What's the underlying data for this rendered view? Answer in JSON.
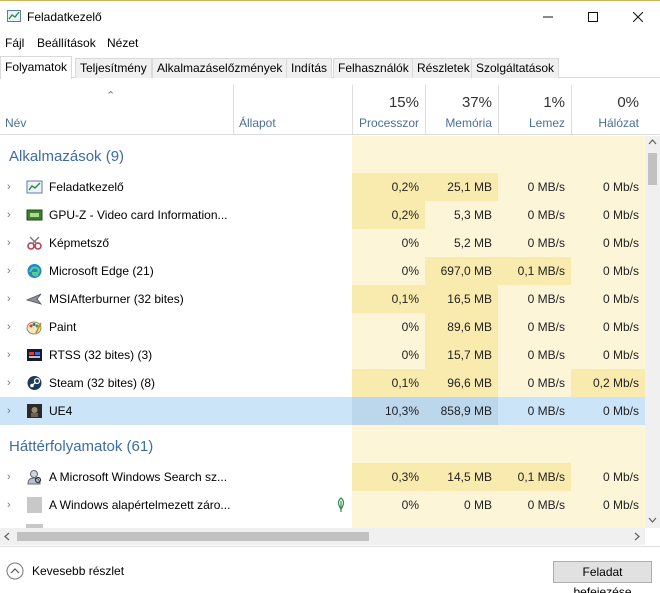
{
  "window": {
    "title": "Feladatkezelő",
    "minimize_icon": "minimize-icon",
    "maximize_icon": "maximize-icon",
    "close_icon": "close-icon"
  },
  "menu": [
    "Fájl",
    "Beállítások",
    "Nézet"
  ],
  "tabs": [
    "Folyamatok",
    "Teljesítmény",
    "Alkalmazáselőzmények",
    "Indítás",
    "Felhasználók",
    "Részletek",
    "Szolgáltatások"
  ],
  "active_tab": "Folyamatok",
  "header": {
    "name": "Név",
    "status": "Állapot",
    "cpu_pct": "15%",
    "cpu_label": "Processzor",
    "mem_pct": "37%",
    "mem_label": "Memória",
    "disk_pct": "1%",
    "disk_label": "Lemez",
    "net_pct": "0%",
    "net_label": "Hálózat"
  },
  "groups": {
    "apps": "Alkalmazások (9)",
    "background": "Háttérfolyamatok (61)"
  },
  "apps": [
    {
      "name": "Feladatkezelő",
      "icon": "task-manager-icon",
      "cpu": "0,2%",
      "mem": "25,1 MB",
      "disk": "0 MB/s",
      "net": "0 Mb/s"
    },
    {
      "name": "GPU-Z - Video card Information...",
      "icon": "gpu-z-icon",
      "cpu": "0,2%",
      "mem": "5,3 MB",
      "disk": "0 MB/s",
      "net": "0 Mb/s"
    },
    {
      "name": "Képmetsző",
      "icon": "snipping-tool-icon",
      "cpu": "0%",
      "mem": "5,2 MB",
      "disk": "0 MB/s",
      "net": "0 Mb/s"
    },
    {
      "name": "Microsoft Edge (21)",
      "icon": "edge-icon",
      "cpu": "0%",
      "mem": "697,0 MB",
      "disk": "0,1 MB/s",
      "net": "0 Mb/s"
    },
    {
      "name": "MSIAfterburner (32 bites)",
      "icon": "afterburner-icon",
      "cpu": "0,1%",
      "mem": "16,5 MB",
      "disk": "0 MB/s",
      "net": "0 Mb/s"
    },
    {
      "name": "Paint",
      "icon": "paint-icon",
      "cpu": "0%",
      "mem": "89,6 MB",
      "disk": "0 MB/s",
      "net": "0 Mb/s"
    },
    {
      "name": "RTSS (32 bites) (3)",
      "icon": "rtss-icon",
      "cpu": "0%",
      "mem": "15,7 MB",
      "disk": "0 MB/s",
      "net": "0 Mb/s"
    },
    {
      "name": "Steam (32 bites) (8)",
      "icon": "steam-icon",
      "cpu": "0,1%",
      "mem": "96,6 MB",
      "disk": "0 MB/s",
      "net": "0,2 Mb/s"
    },
    {
      "name": "UE4",
      "icon": "ue4-icon",
      "cpu": "10,3%",
      "mem": "858,9 MB",
      "disk": "0 MB/s",
      "net": "0 Mb/s"
    }
  ],
  "background": [
    {
      "name": "A Microsoft Windows Search sz...",
      "icon": "search-indexer-icon",
      "cpu": "0,3%",
      "mem": "14,5 MB",
      "disk": "0,1 MB/s",
      "net": "0 Mb/s"
    },
    {
      "name": "A Windows alapértelmezett záro...",
      "icon": "lock-app-icon",
      "status_icon": "leaf-icon",
      "cpu": "0%",
      "mem": "0 MB",
      "disk": "0 MB/s",
      "net": "0 Mb/s"
    }
  ],
  "footer": {
    "less_details": "Kevesebb részlet",
    "end_task": "Feladat befejezése"
  },
  "colors": {
    "heat_light": "#fdf5d8",
    "heat": "#f9eaae",
    "selected_row": "#cce4f7",
    "group_text": "#3c6ca8"
  }
}
